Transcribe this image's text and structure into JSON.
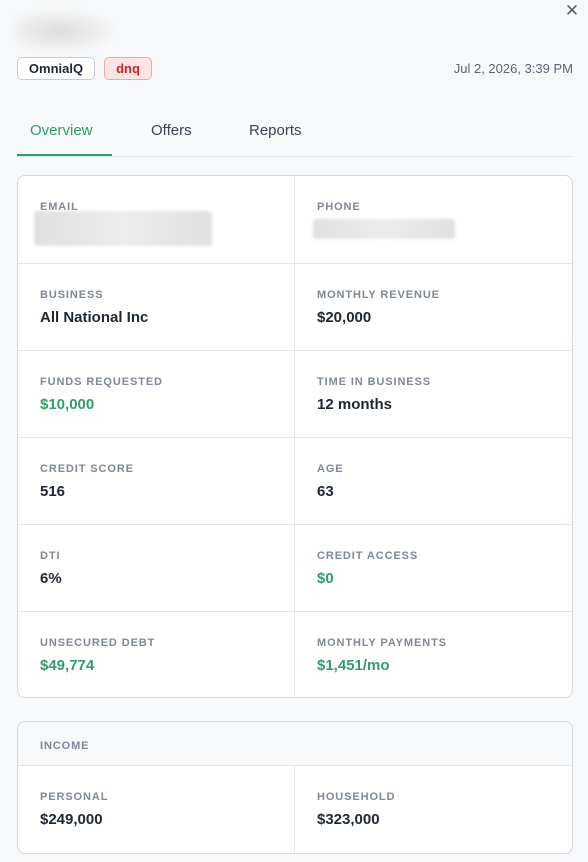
{
  "header": {
    "close_icon": "close-icon",
    "chips": [
      "OmnialQ",
      "dnq"
    ],
    "timestamp": "Jul 2, 2026, 3:39 PM"
  },
  "tabs": [
    {
      "label": "Overview",
      "active": true
    },
    {
      "label": "Offers",
      "active": false
    },
    {
      "label": "Reports",
      "active": false
    }
  ],
  "overview": {
    "email": {
      "label": "EMAIL",
      "value": ""
    },
    "phone": {
      "label": "PHONE",
      "value": ""
    },
    "business": {
      "label": "BUSINESS",
      "value": "All National Inc"
    },
    "monthly_revenue": {
      "label": "MONTHLY REVENUE",
      "value": "$20,000"
    },
    "funds_requested": {
      "label": "FUNDS REQUESTED",
      "value": "$10,000"
    },
    "time_in_business": {
      "label": "TIME IN BUSINESS",
      "value": "12 months"
    },
    "credit_score": {
      "label": "CREDIT SCORE",
      "value": "516"
    },
    "age": {
      "label": "AGE",
      "value": "63"
    },
    "dti": {
      "label": "DTI",
      "value": "6%"
    },
    "credit_access": {
      "label": "CREDIT ACCESS",
      "value": "$0"
    },
    "unsecured_debt": {
      "label": "UNSECURED DEBT",
      "value": "$49,774"
    },
    "monthly_payments": {
      "label": "MONTHLY PAYMENTS",
      "value": "$1,451/mo"
    }
  },
  "income": {
    "title": "INCOME",
    "personal": {
      "label": "PERSONAL",
      "value": "$249,000"
    },
    "household": {
      "label": "HOUSEHOLD",
      "value": "$323,000"
    }
  },
  "colors": {
    "accent": "#2e9e6b",
    "danger": "#c62828",
    "muted": "#7f8896"
  }
}
